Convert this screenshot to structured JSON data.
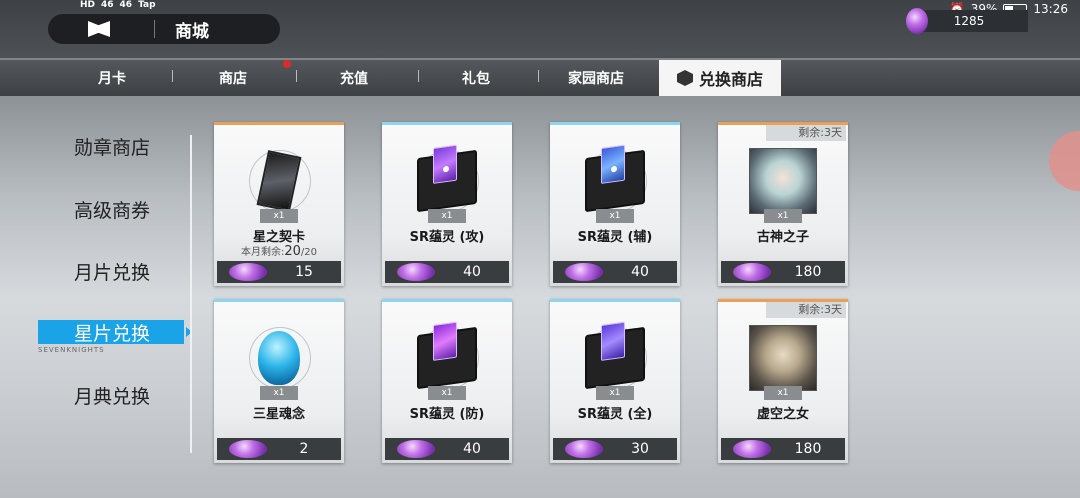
{
  "status_bar": {
    "left_items": [
      "HD",
      "HD",
      "46",
      "46",
      "Tap"
    ],
    "battery": "39%",
    "time": "13:26"
  },
  "header": {
    "title": "商城",
    "currency_amount": "1285"
  },
  "tabs": [
    {
      "label": "月卡"
    },
    {
      "label": "商店"
    },
    {
      "label": "充值"
    },
    {
      "label": "礼包"
    },
    {
      "label": "家园商店"
    },
    {
      "label": "兑换商店",
      "active": true
    }
  ],
  "sidebar": {
    "items": [
      {
        "label": "勋章商店"
      },
      {
        "label": "高级商券"
      },
      {
        "label": "月片兑换"
      },
      {
        "label": "星片兑换",
        "active": true
      },
      {
        "label": "月典兑换"
      }
    ],
    "ghost_text": "SEVENKNIGHTS"
  },
  "items": [
    {
      "name": "星之契卡",
      "qty": "x1",
      "limit_prefix": "本月剩余:",
      "limit_current": "20",
      "limit_total": "/20",
      "price": "15",
      "accent": "#e8a05a"
    },
    {
      "name": "SR蕴灵 (攻)",
      "qty": "x1",
      "price": "40",
      "accent": "#8fd3f0"
    },
    {
      "name": "SR蕴灵 (辅)",
      "qty": "x1",
      "price": "40",
      "accent": "#8fd3f0"
    },
    {
      "name": "古神之子",
      "qty": "x1",
      "remain": "剩余:3天",
      "price": "180",
      "accent": "#e8a05a"
    },
    {
      "name": "三星魂念",
      "qty": "x1",
      "price": "2",
      "accent": "#8fd3f0"
    },
    {
      "name": "SR蕴灵 (防)",
      "qty": "x1",
      "price": "40",
      "accent": "#8fd3f0"
    },
    {
      "name": "SR蕴灵 (全)",
      "qty": "x1",
      "price": "30",
      "accent": "#8fd3f0"
    },
    {
      "name": "虚空之女",
      "qty": "x1",
      "remain": "剩余:3天",
      "price": "180",
      "accent": "#e8a05a"
    }
  ],
  "icons": {
    "currency": "purple-gem-icon",
    "active_tab": "cube-icon"
  }
}
